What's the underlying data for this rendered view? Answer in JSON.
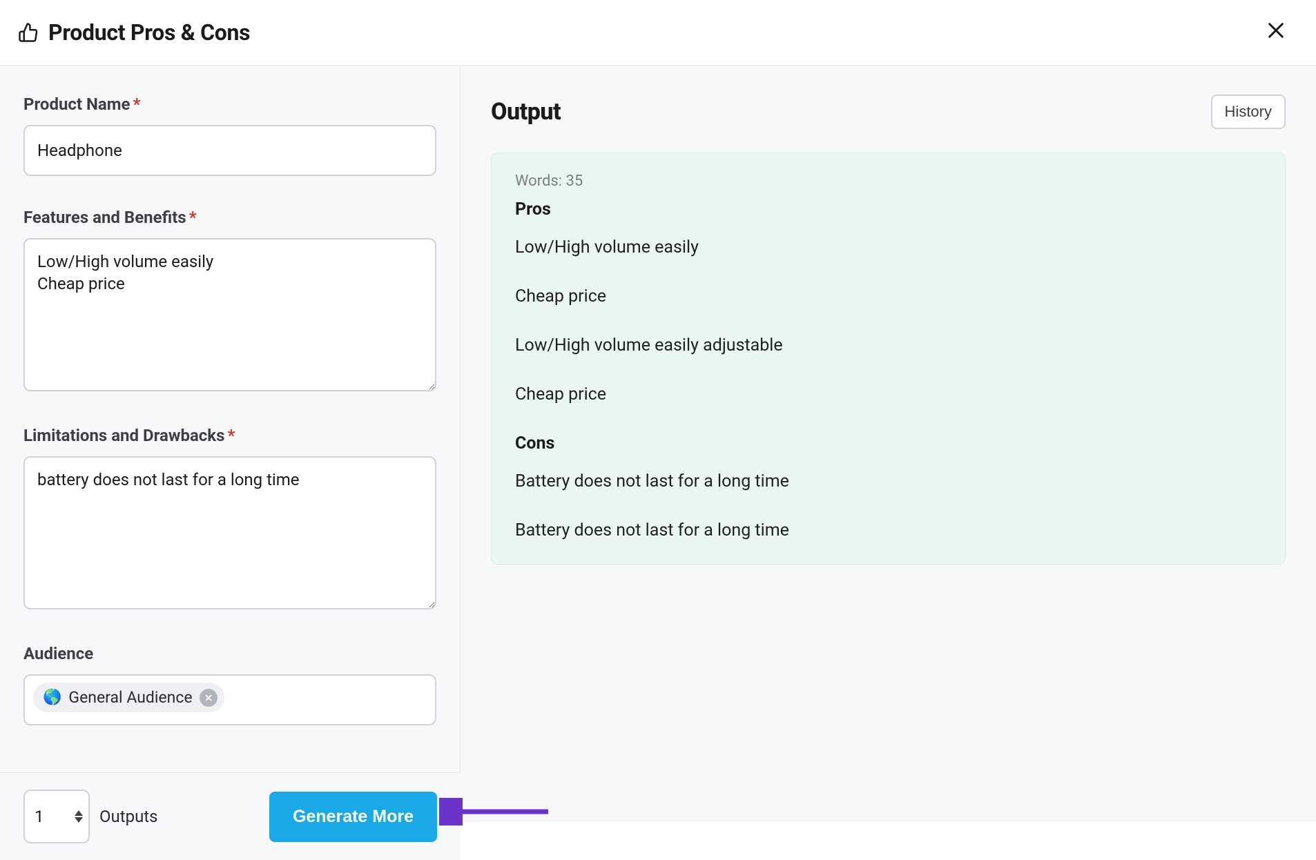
{
  "header": {
    "title": "Product Pros & Cons"
  },
  "form": {
    "product_name": {
      "label": "Product Name",
      "value": "Headphone",
      "required": true
    },
    "features": {
      "label": "Features and Benefits",
      "value": "Low/High volume easily\nCheap price",
      "required": true
    },
    "limitations": {
      "label": "Limitations and Drawbacks",
      "value": "battery does not last for a long time",
      "required": true
    },
    "audience": {
      "label": "Audience",
      "chip_icon": "🌎",
      "chip_label": "General Audience"
    }
  },
  "bottom": {
    "outputs_value": "1",
    "outputs_label": "Outputs",
    "generate_label": "Generate More"
  },
  "output": {
    "title": "Output",
    "history_label": "History",
    "words_label": "Words: 35",
    "pros_title": "Pros",
    "pros_items": [
      "Low/High volume easily",
      "Cheap price",
      "Low/High volume easily adjustable",
      "Cheap price"
    ],
    "cons_title": "Cons",
    "cons_items": [
      "Battery does not last for a long time",
      "Battery does not last for a long time"
    ]
  }
}
